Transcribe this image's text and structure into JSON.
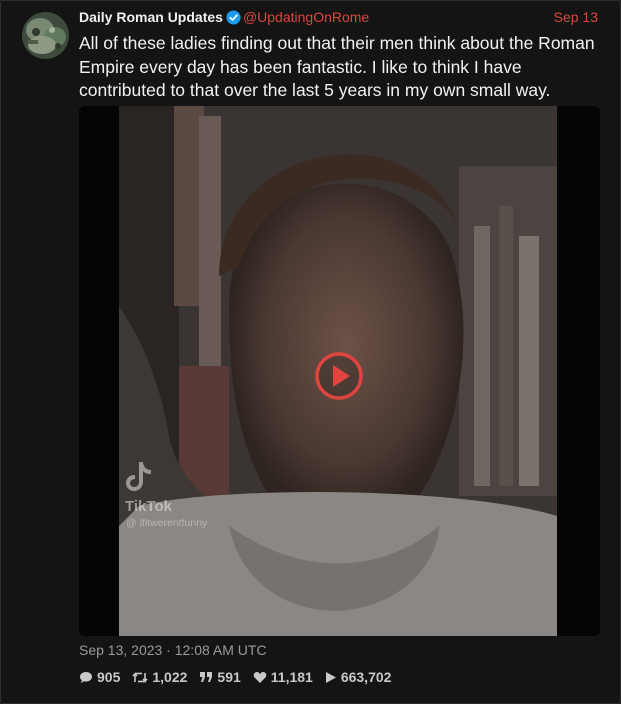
{
  "tweet": {
    "author_name": "Daily Roman Updates",
    "handle": "@UpdatingOnRome",
    "date": "Sep 13",
    "text": "All of these ladies finding out that their men think about the Roman Empire every day has been fantastic. I like to think I have contributed to that over the last 5 years in my own small way.",
    "timestamp": "Sep 13, 2023 · 12:08 AM UTC",
    "icons": {
      "avatar": "avatar-image",
      "verified": "verified-badge-icon",
      "play": "play-button-icon",
      "tiktok": "tiktok-logo-icon"
    },
    "colors": {
      "accent": "#e0453d",
      "verified": "#1d9bf0"
    }
  },
  "media": {
    "tiktok_word": "TikTok",
    "tiktok_user": "@ ifitwerentfunny"
  },
  "stats": {
    "replies": "905",
    "retweets": "1,022",
    "quotes": "591",
    "likes": "11,181",
    "views": "663,702"
  }
}
